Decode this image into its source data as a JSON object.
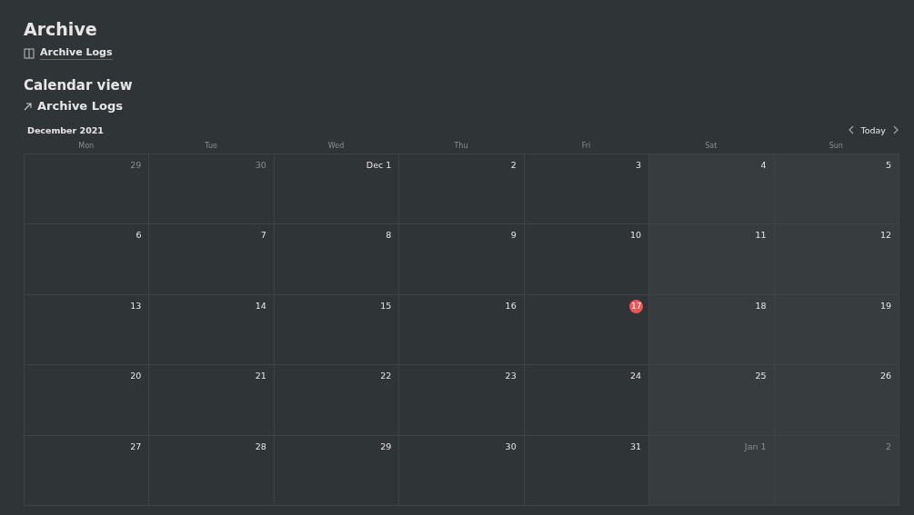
{
  "page": {
    "title": "Archive",
    "link": "Archive Logs"
  },
  "calendar": {
    "heading": "Calendar view",
    "database_link": "Archive Logs",
    "month": "December 2021",
    "today_button": "Today",
    "weekdays": [
      "Mon",
      "Tue",
      "Wed",
      "Thu",
      "Fri",
      "Sat",
      "Sun"
    ],
    "days": [
      {
        "label": "29",
        "muted": true,
        "today": false
      },
      {
        "label": "30",
        "muted": true,
        "today": false
      },
      {
        "label": "Dec 1",
        "muted": false,
        "today": false
      },
      {
        "label": "2",
        "muted": false,
        "today": false
      },
      {
        "label": "3",
        "muted": false,
        "today": false
      },
      {
        "label": "4",
        "muted": false,
        "today": false
      },
      {
        "label": "5",
        "muted": false,
        "today": false
      },
      {
        "label": "6",
        "muted": false,
        "today": false
      },
      {
        "label": "7",
        "muted": false,
        "today": false
      },
      {
        "label": "8",
        "muted": false,
        "today": false
      },
      {
        "label": "9",
        "muted": false,
        "today": false
      },
      {
        "label": "10",
        "muted": false,
        "today": false
      },
      {
        "label": "11",
        "muted": false,
        "today": false
      },
      {
        "label": "12",
        "muted": false,
        "today": false
      },
      {
        "label": "13",
        "muted": false,
        "today": false
      },
      {
        "label": "14",
        "muted": false,
        "today": false
      },
      {
        "label": "15",
        "muted": false,
        "today": false
      },
      {
        "label": "16",
        "muted": false,
        "today": false
      },
      {
        "label": "17",
        "muted": false,
        "today": true
      },
      {
        "label": "18",
        "muted": false,
        "today": false
      },
      {
        "label": "19",
        "muted": false,
        "today": false
      },
      {
        "label": "20",
        "muted": false,
        "today": false
      },
      {
        "label": "21",
        "muted": false,
        "today": false
      },
      {
        "label": "22",
        "muted": false,
        "today": false
      },
      {
        "label": "23",
        "muted": false,
        "today": false
      },
      {
        "label": "24",
        "muted": false,
        "today": false
      },
      {
        "label": "25",
        "muted": false,
        "today": false
      },
      {
        "label": "26",
        "muted": false,
        "today": false
      },
      {
        "label": "27",
        "muted": false,
        "today": false
      },
      {
        "label": "28",
        "muted": false,
        "today": false
      },
      {
        "label": "29",
        "muted": false,
        "today": false
      },
      {
        "label": "30",
        "muted": false,
        "today": false
      },
      {
        "label": "31",
        "muted": false,
        "today": false
      },
      {
        "label": "Jan 1",
        "muted": true,
        "today": false
      },
      {
        "label": "2",
        "muted": true,
        "today": false
      }
    ]
  }
}
